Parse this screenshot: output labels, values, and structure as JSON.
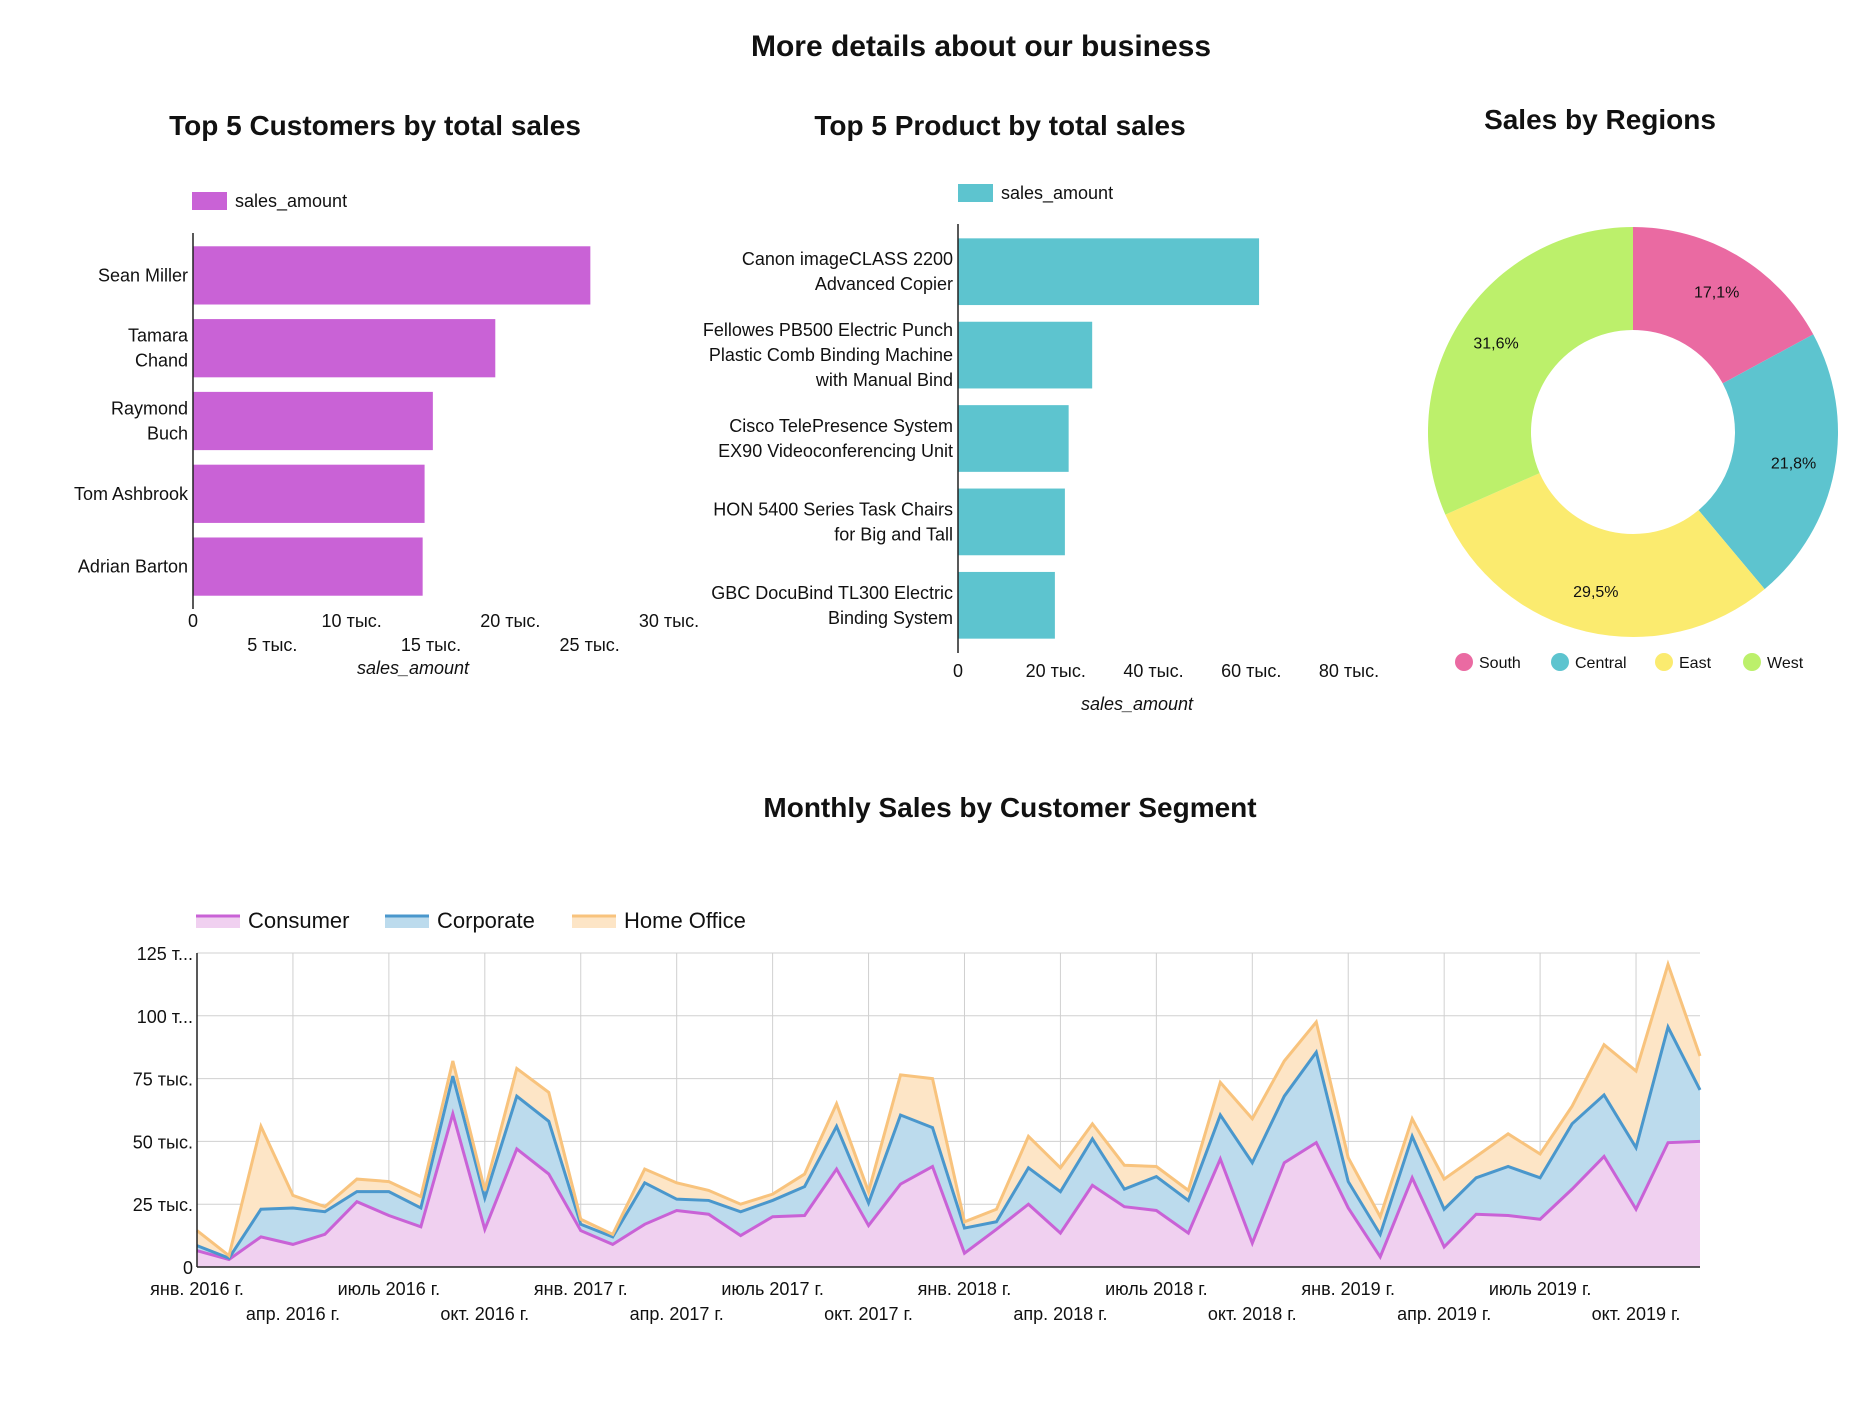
{
  "page": {
    "title": "More details about our business"
  },
  "chart_data": [
    {
      "type": "bar",
      "orientation": "horizontal",
      "title": "Top 5 Customers by total sales",
      "legend": "sales_amount",
      "legend_position": "top",
      "color": "#c962d6",
      "categories": [
        [
          "Sean Miller"
        ],
        [
          "Tamara",
          "Chand"
        ],
        [
          "Raymond",
          "Buch"
        ],
        [
          "Tom Ashbrook"
        ],
        [
          "Adrian Barton"
        ]
      ],
      "values": [
        25043,
        19052,
        15117,
        14596,
        14474
      ],
      "xlabel": "sales_amount",
      "xlim": [
        0,
        30000
      ],
      "ticks": [
        0,
        5000,
        10000,
        15000,
        20000,
        25000,
        30000
      ],
      "tick_labels": [
        "0",
        "5 тыс.",
        "10 тыс.",
        "15 тыс.",
        "20 тыс.",
        "25 тыс.",
        "30 тыс."
      ]
    },
    {
      "type": "bar",
      "orientation": "horizontal",
      "title": "Top 5 Product by total sales",
      "legend": "sales_amount",
      "legend_position": "top",
      "color": "#5dc4cf",
      "categories": [
        [
          "Canon imageCLASS 2200",
          "Advanced Copier"
        ],
        [
          "Fellowes PB500 Electric Punch",
          "Plastic Comb Binding Machine",
          "with Manual Bind"
        ],
        [
          "Cisco TelePresence System",
          "EX90 Videoconferencing Unit"
        ],
        [
          "HON 5400 Series Task Chairs",
          "for Big and Tall"
        ],
        [
          "GBC DocuBind TL300 Electric",
          "Binding System"
        ]
      ],
      "values": [
        61600,
        27453,
        22638,
        21871,
        19823
      ],
      "xlabel": "sales_amount",
      "xlim": [
        0,
        80000
      ],
      "ticks": [
        0,
        20000,
        40000,
        60000,
        80000
      ],
      "tick_labels": [
        "0",
        "20 тыс.",
        "40 тыс.",
        "60 тыс.",
        "80 тыс."
      ]
    },
    {
      "type": "pie",
      "donut": true,
      "title": "Sales by Regions",
      "legend_position": "bottom",
      "labels": [
        "South",
        "Central",
        "East",
        "West"
      ],
      "values": [
        17.1,
        21.8,
        29.5,
        31.6
      ],
      "value_labels": [
        "17,1%",
        "21,8%",
        "29,5%",
        "31,6%"
      ],
      "colors": [
        "#ea6aa2",
        "#5dc4cf",
        "#fbeb6f",
        "#bcf06b"
      ]
    },
    {
      "type": "area",
      "stacked": true,
      "title": "Monthly Sales by Customer Segment",
      "legend_position": "top",
      "x": [
        "2016-01",
        "2016-02",
        "2016-03",
        "2016-04",
        "2016-05",
        "2016-06",
        "2016-07",
        "2016-08",
        "2016-09",
        "2016-10",
        "2016-11",
        "2016-12",
        "2017-01",
        "2017-02",
        "2017-03",
        "2017-04",
        "2017-05",
        "2017-06",
        "2017-07",
        "2017-08",
        "2017-09",
        "2017-10",
        "2017-11",
        "2017-12",
        "2018-01",
        "2018-02",
        "2018-03",
        "2018-04",
        "2018-05",
        "2018-06",
        "2018-07",
        "2018-08",
        "2018-09",
        "2018-10",
        "2018-11",
        "2018-12",
        "2019-01",
        "2019-02",
        "2019-03",
        "2019-04",
        "2019-05",
        "2019-06",
        "2019-07",
        "2019-08",
        "2019-09",
        "2019-10",
        "2019-11",
        "2019-12"
      ],
      "x_tick_labels": [
        "янв. 2016 г.",
        "апр. 2016 г.",
        "июль 2016 г.",
        "окт. 2016 г.",
        "янв. 2017 г.",
        "апр. 2017 г.",
        "июль 2017 г.",
        "окт. 2017 г.",
        "янв. 2018 г.",
        "апр. 2018 г.",
        "июль 2018 г.",
        "окт. 2018 г.",
        "янв. 2019 г.",
        "апр. 2019 г.",
        "июль 2019 г.",
        "окт. 2019 г."
      ],
      "y_tick_labels": [
        "0",
        "25 тыс.",
        "50 тыс.",
        "75 тыс.",
        "100 т...",
        "125 т..."
      ],
      "ylim": [
        0,
        125000
      ],
      "grid": true,
      "series": [
        {
          "name": "Consumer",
          "color": "#c962d6",
          "fill": "#f0d0f0",
          "values": [
            6500,
            3000,
            12000,
            9000,
            13000,
            26000,
            20500,
            16000,
            61000,
            15000,
            47000,
            37000,
            14500,
            9000,
            17000,
            22500,
            21000,
            12500,
            20000,
            20500,
            39000,
            16500,
            33000,
            40000,
            5500,
            15000,
            25000,
            13500,
            32500,
            24000,
            22500,
            13500,
            43000,
            9500,
            41500,
            49500,
            23500,
            4000,
            35500,
            8000,
            21000,
            20500,
            19000,
            31000,
            44000,
            23000,
            49500,
            50000
          ]
        },
        {
          "name": "Corporate",
          "color": "#4a97cc",
          "fill": "#bcdbed",
          "values": [
            2000,
            500,
            11000,
            14500,
            9000,
            4000,
            9500,
            7500,
            15000,
            12500,
            21000,
            21000,
            2500,
            3000,
            16500,
            4500,
            5500,
            9500,
            6500,
            11500,
            17000,
            9000,
            27500,
            15500,
            10000,
            3000,
            14500,
            16500,
            18500,
            7000,
            13500,
            13000,
            17500,
            32000,
            26500,
            36000,
            10500,
            9000,
            16500,
            15000,
            14500,
            19500,
            16500,
            26000,
            24500,
            24500,
            46000,
            20500
          ]
        },
        {
          "name": "Home Office",
          "color": "#f8c37d",
          "fill": "#fde5c6",
          "values": [
            6000,
            1000,
            33000,
            5000,
            2000,
            5000,
            4000,
            4500,
            6000,
            3000,
            11000,
            11500,
            2000,
            1000,
            5500,
            6500,
            4000,
            3000,
            2500,
            5000,
            9000,
            4500,
            16000,
            19500,
            2500,
            5000,
            12500,
            9500,
            6000,
            9500,
            4000,
            4000,
            13000,
            17500,
            14000,
            12000,
            9500,
            7000,
            7000,
            12000,
            8500,
            13000,
            9500,
            7000,
            20000,
            30500,
            25000,
            13500
          ]
        }
      ]
    }
  ]
}
